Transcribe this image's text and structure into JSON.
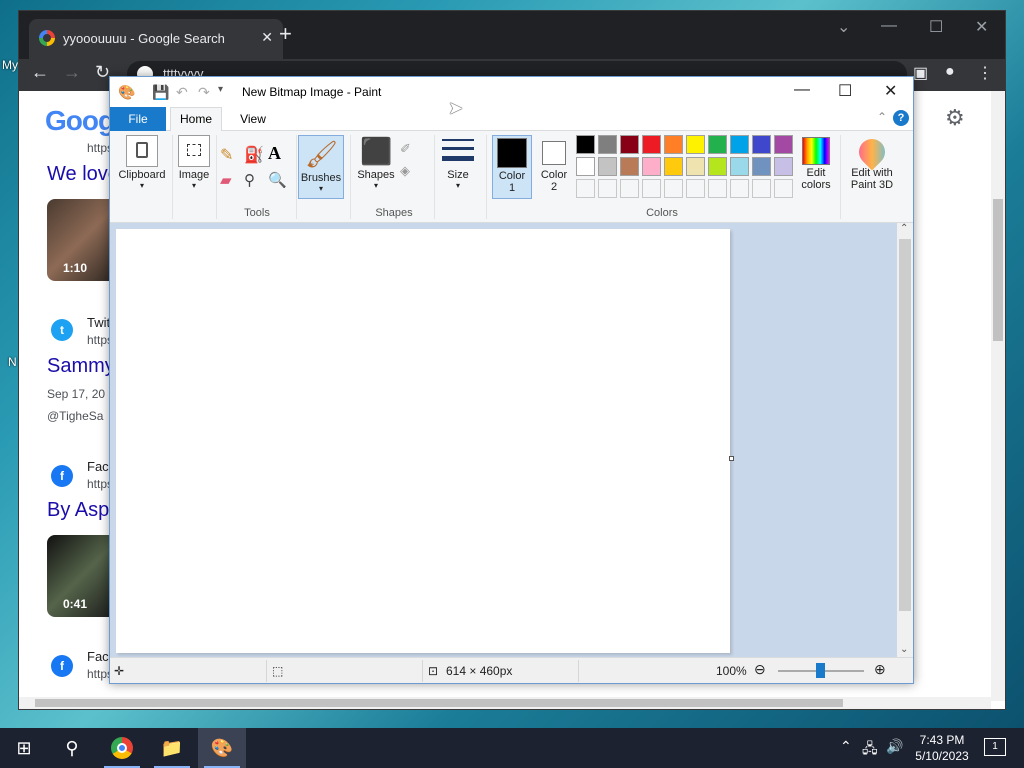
{
  "desktop": {
    "left_texts": [
      "My",
      "N"
    ]
  },
  "chrome": {
    "tab_title": "yyooouuuu - Google Search",
    "new_tab": "+",
    "omnibox": "ttttyyyy",
    "page": {
      "logo": "Google",
      "results": [
        {
          "url_fragment": "https",
          "heading": "We love",
          "duration": "1:10"
        },
        {
          "source": "Twit",
          "url_fragment": "https",
          "heading": "Sammy",
          "date": "Sep 17, 20",
          "handle": "@TigheSa"
        },
        {
          "source": "Fac",
          "url_fragment": "https",
          "heading": "By Asp",
          "duration": "0:41"
        },
        {
          "source": "Fac",
          "url_fragment": "https"
        }
      ]
    }
  },
  "paint": {
    "title": "New Bitmap Image - Paint",
    "tabs": {
      "file": "File",
      "home": "Home",
      "view": "View"
    },
    "ribbon": {
      "clipboard": "Clipboard",
      "image": "Image",
      "tools_group": "Tools",
      "brushes": "Brushes",
      "shapes": "Shapes",
      "shapes_group": "Shapes",
      "size": "Size",
      "color1": "Color 1",
      "color1_line1": "Color",
      "color1_line2": "1",
      "color2_line1": "Color",
      "color2_line2": "2",
      "colors_group": "Colors",
      "edit_colors_line1": "Edit",
      "edit_colors_line2": "colors",
      "edit_paint3d_line1": "Edit with",
      "edit_paint3d_line2": "Paint 3D"
    },
    "palette_row1": [
      "#000000",
      "#7f7f7f",
      "#880015",
      "#ed1c24",
      "#ff7f27",
      "#fff200",
      "#22b14c",
      "#00a2e8",
      "#3f48cc",
      "#a349a4"
    ],
    "palette_row2": [
      "#ffffff",
      "#c3c3c3",
      "#b97a57",
      "#ffaec9",
      "#ffc90e",
      "#efe4b0",
      "#b5e61d",
      "#99d9ea",
      "#7092be",
      "#c8bfe7"
    ],
    "status": {
      "dimensions": "614 × 460px",
      "zoom": "100%"
    }
  },
  "taskbar": {
    "time": "7:43 PM",
    "date": "5/10/2023",
    "notifications": "1"
  }
}
